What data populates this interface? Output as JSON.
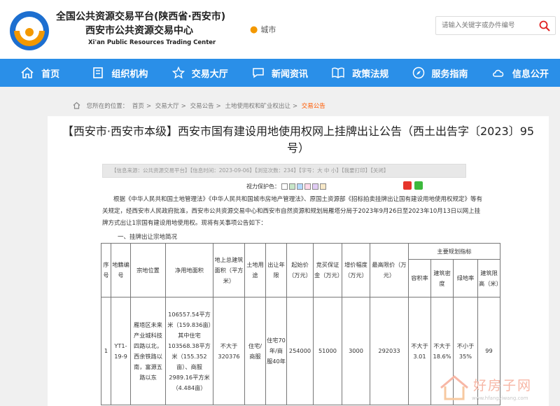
{
  "header": {
    "title_line1": "全国公共资源交易平台(陕西省·西安市)",
    "title_line2": "西安市公共资源交易中心",
    "title_en": "Xi'an Public Resources Trading Center",
    "city_label": "城市",
    "search_placeholder": "请输入关键字或办件编号"
  },
  "nav": [
    {
      "label": "首页",
      "icon": "home-icon"
    },
    {
      "label": "组织机构",
      "icon": "building-icon"
    },
    {
      "label": "交易大厅",
      "icon": "star-icon"
    },
    {
      "label": "新闻资讯",
      "icon": "chat-icon"
    },
    {
      "label": "政策法规",
      "icon": "book-icon"
    },
    {
      "label": "服务指南",
      "icon": "compass-icon"
    },
    {
      "label": "信息公开",
      "icon": "cloud-icon"
    }
  ],
  "breadcrumb": {
    "prefix": "您所在的位置：",
    "items": [
      "首页",
      "交易大厅",
      "交易公告",
      "土地使用权和矿业权出让"
    ],
    "current": "交易公告",
    "separator": ">"
  },
  "article": {
    "title": "【西安市·西安市本级】西安市国有建设用地使用权网上挂牌出让公告（西土出告字〔2023〕95号）",
    "info_bar": "【信息来源：公共资源交易平台】【信息时间：2023-09-06】【浏览次数：234】【字号：大 中 小】【我要打印】【关闭】",
    "protect_label": "视力保护色：",
    "protect_colors": [
      "#ffffff",
      "#c8e6c9",
      "#b3d9ff",
      "#ffd8e8",
      "#e1ccf5",
      "#f7e8c8"
    ],
    "paragraph": "根据《中华人民共和国土地管理法》《中华人民共和国城市房地产管理法》、原国土资源部《招标拍卖挂牌出让国有建设用地使用权规定》等有关规定，经西安市人民政府批准，西安市公共资源交易中心和西安市自然资源和规划局雁塔分局于2023年9月26日至2023年10月13日以网上挂牌方式出让1宗国有建设用地使用权。现将有关事项公告如下：",
    "subheading": "一、挂牌出让宗地简况"
  },
  "table": {
    "headers": [
      "序号",
      "地籍编号",
      "宗地位置",
      "净用地面积",
      "地上总建筑面积（平方米）",
      "土地用途",
      "出让年限",
      "起始价（万元）",
      "竞买保证金（万元）",
      "增价幅度（万元）",
      "最高限价（万元）"
    ],
    "group_header": "主要规划指标",
    "sub_headers": [
      "容积率",
      "建筑密度",
      "绿地率",
      "建筑限高（米）"
    ],
    "rows": [
      {
        "seq": "1",
        "parcel": "YT1-19-9",
        "location": "雁塔区未来产业城科技四路以北，西余铁路以南，富源五路以东",
        "area": "106557.54平方米（159.836亩）其中住宅103568.38平方米（155.352亩）、商服2989.16平方米（4.484亩）",
        "gfa": "不大于320376",
        "usage": "住宅/商服",
        "term": "住宅70年/商服40年",
        "start_price": "254000",
        "deposit": "51000",
        "increment": "3000",
        "max_price": "292033",
        "far": "不大于3.01",
        "density": "不大于18.6%",
        "green": "不小于35%",
        "height": "99"
      }
    ]
  },
  "watermark": {
    "text": "好房子网",
    "url": "www.hfangziwang.com"
  }
}
